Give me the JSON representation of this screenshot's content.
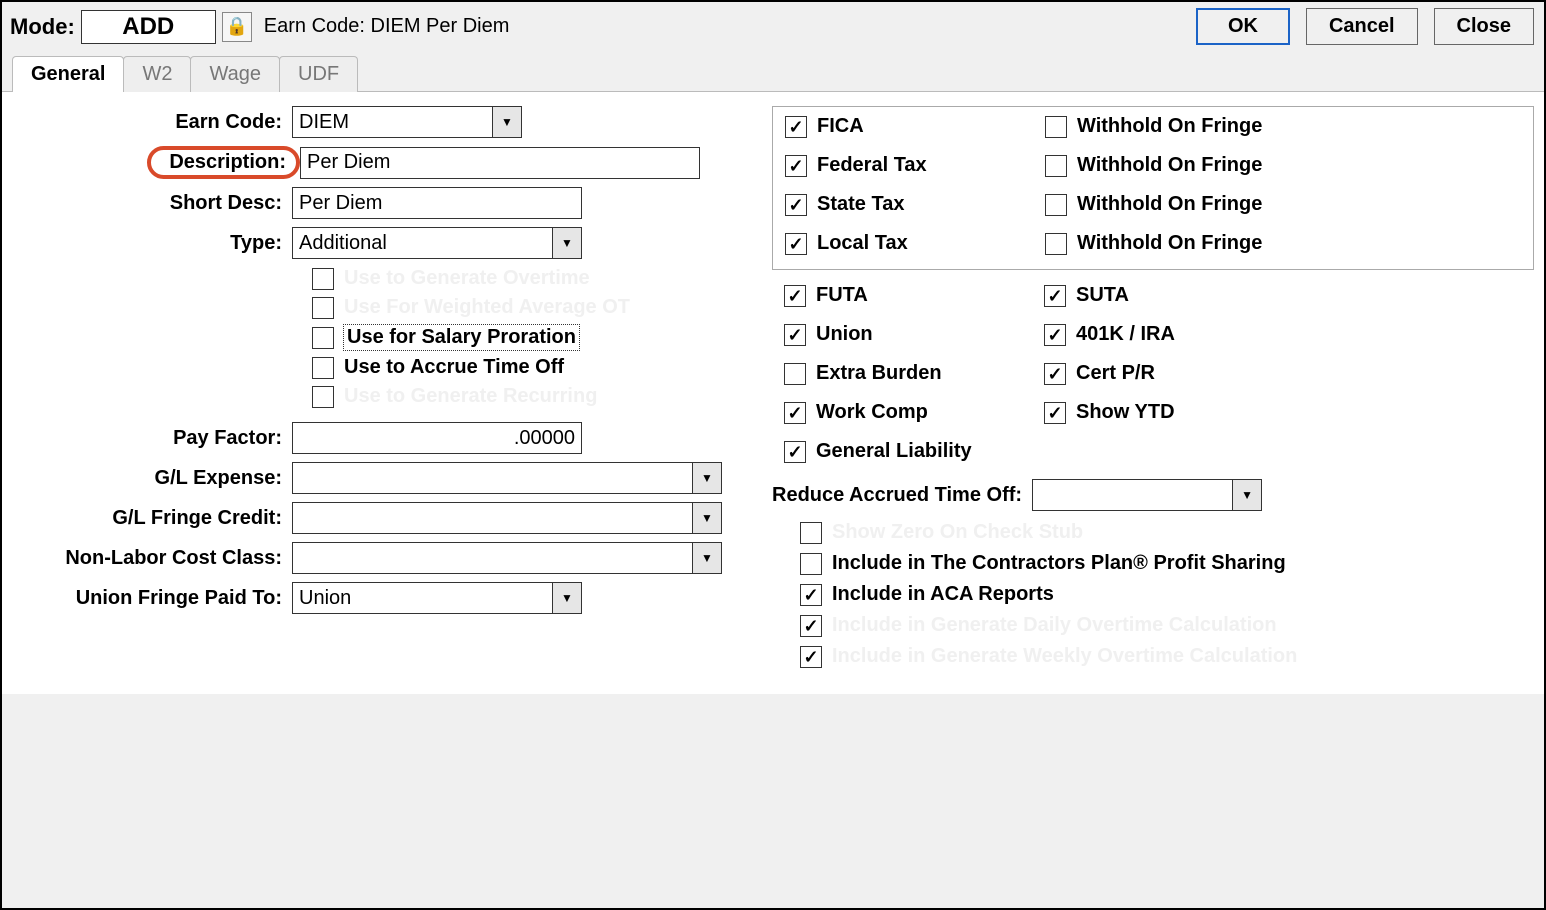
{
  "topbar": {
    "mode_label": "Mode:",
    "mode_value": "ADD",
    "earn_code_text": "Earn Code: DIEM  Per Diem",
    "ok": "OK",
    "cancel": "Cancel",
    "close": "Close"
  },
  "tabs": [
    "General",
    "W2",
    "Wage",
    "UDF"
  ],
  "form": {
    "earn_code_label": "Earn Code:",
    "earn_code_value": "DIEM",
    "description_label": "Description:",
    "description_value": "Per Diem",
    "short_desc_label": "Short Desc:",
    "short_desc_value": "Per Diem",
    "type_label": "Type:",
    "type_value": "Additional",
    "chk_overtime": "Use to Generate Overtime",
    "chk_weighted": "Use For Weighted Average OT",
    "chk_salary": "Use for Salary Proration",
    "chk_accrue": "Use to Accrue Time Off",
    "chk_recurring": "Use to Generate Recurring",
    "pay_factor_label": "Pay Factor:",
    "pay_factor_value": ".00000",
    "gl_expense_label": "G/L Expense:",
    "gl_expense_value": "",
    "gl_fringe_label": "G/L Fringe Credit:",
    "gl_fringe_value": "",
    "non_labor_label": "Non-Labor Cost Class:",
    "non_labor_value": "",
    "union_fringe_label": "Union Fringe Paid To:",
    "union_fringe_value": "Union"
  },
  "taxes": {
    "fica": "FICA",
    "federal": "Federal Tax",
    "state": "State Tax",
    "local": "Local Tax",
    "withhold": "Withhold On Fringe"
  },
  "other": {
    "futa": "FUTA",
    "suta": "SUTA",
    "union": "Union",
    "k401": "401K / IRA",
    "extra": "Extra Burden",
    "cert": "Cert P/R",
    "workcomp": "Work Comp",
    "showytd": "Show YTD",
    "genliab": "General Liability"
  },
  "reduce": {
    "label": "Reduce Accrued Time Off:",
    "value": "",
    "show_zero": "Show Zero On Check Stub",
    "profit_sharing": "Include in The Contractors Plan® Profit Sharing",
    "aca": "Include in ACA Reports",
    "daily_ot": "Include in Generate Daily Overtime Calculation",
    "weekly_ot": "Include in Generate Weekly Overtime Calculation"
  }
}
